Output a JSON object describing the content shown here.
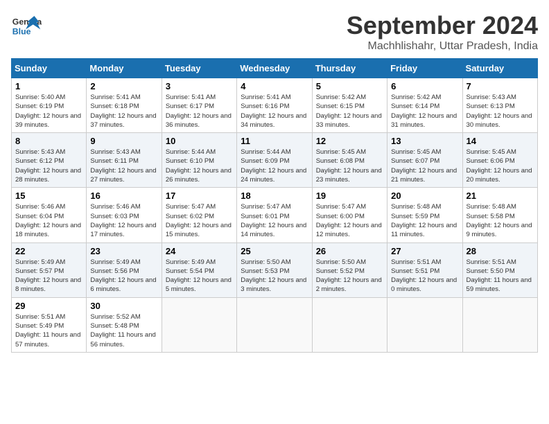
{
  "header": {
    "logo_general": "General",
    "logo_blue": "Blue",
    "month": "September 2024",
    "location": "Machhlishahr, Uttar Pradesh, India"
  },
  "weekdays": [
    "Sunday",
    "Monday",
    "Tuesday",
    "Wednesday",
    "Thursday",
    "Friday",
    "Saturday"
  ],
  "weeks": [
    [
      {
        "day": "1",
        "sunrise": "5:40 AM",
        "sunset": "6:19 PM",
        "daylight": "12 hours and 39 minutes."
      },
      {
        "day": "2",
        "sunrise": "5:41 AM",
        "sunset": "6:18 PM",
        "daylight": "12 hours and 37 minutes."
      },
      {
        "day": "3",
        "sunrise": "5:41 AM",
        "sunset": "6:17 PM",
        "daylight": "12 hours and 36 minutes."
      },
      {
        "day": "4",
        "sunrise": "5:41 AM",
        "sunset": "6:16 PM",
        "daylight": "12 hours and 34 minutes."
      },
      {
        "day": "5",
        "sunrise": "5:42 AM",
        "sunset": "6:15 PM",
        "daylight": "12 hours and 33 minutes."
      },
      {
        "day": "6",
        "sunrise": "5:42 AM",
        "sunset": "6:14 PM",
        "daylight": "12 hours and 31 minutes."
      },
      {
        "day": "7",
        "sunrise": "5:43 AM",
        "sunset": "6:13 PM",
        "daylight": "12 hours and 30 minutes."
      }
    ],
    [
      {
        "day": "8",
        "sunrise": "5:43 AM",
        "sunset": "6:12 PM",
        "daylight": "12 hours and 28 minutes."
      },
      {
        "day": "9",
        "sunrise": "5:43 AM",
        "sunset": "6:11 PM",
        "daylight": "12 hours and 27 minutes."
      },
      {
        "day": "10",
        "sunrise": "5:44 AM",
        "sunset": "6:10 PM",
        "daylight": "12 hours and 26 minutes."
      },
      {
        "day": "11",
        "sunrise": "5:44 AM",
        "sunset": "6:09 PM",
        "daylight": "12 hours and 24 minutes."
      },
      {
        "day": "12",
        "sunrise": "5:45 AM",
        "sunset": "6:08 PM",
        "daylight": "12 hours and 23 minutes."
      },
      {
        "day": "13",
        "sunrise": "5:45 AM",
        "sunset": "6:07 PM",
        "daylight": "12 hours and 21 minutes."
      },
      {
        "day": "14",
        "sunrise": "5:45 AM",
        "sunset": "6:06 PM",
        "daylight": "12 hours and 20 minutes."
      }
    ],
    [
      {
        "day": "15",
        "sunrise": "5:46 AM",
        "sunset": "6:04 PM",
        "daylight": "12 hours and 18 minutes."
      },
      {
        "day": "16",
        "sunrise": "5:46 AM",
        "sunset": "6:03 PM",
        "daylight": "12 hours and 17 minutes."
      },
      {
        "day": "17",
        "sunrise": "5:47 AM",
        "sunset": "6:02 PM",
        "daylight": "12 hours and 15 minutes."
      },
      {
        "day": "18",
        "sunrise": "5:47 AM",
        "sunset": "6:01 PM",
        "daylight": "12 hours and 14 minutes."
      },
      {
        "day": "19",
        "sunrise": "5:47 AM",
        "sunset": "6:00 PM",
        "daylight": "12 hours and 12 minutes."
      },
      {
        "day": "20",
        "sunrise": "5:48 AM",
        "sunset": "5:59 PM",
        "daylight": "12 hours and 11 minutes."
      },
      {
        "day": "21",
        "sunrise": "5:48 AM",
        "sunset": "5:58 PM",
        "daylight": "12 hours and 9 minutes."
      }
    ],
    [
      {
        "day": "22",
        "sunrise": "5:49 AM",
        "sunset": "5:57 PM",
        "daylight": "12 hours and 8 minutes."
      },
      {
        "day": "23",
        "sunrise": "5:49 AM",
        "sunset": "5:56 PM",
        "daylight": "12 hours and 6 minutes."
      },
      {
        "day": "24",
        "sunrise": "5:49 AM",
        "sunset": "5:54 PM",
        "daylight": "12 hours and 5 minutes."
      },
      {
        "day": "25",
        "sunrise": "5:50 AM",
        "sunset": "5:53 PM",
        "daylight": "12 hours and 3 minutes."
      },
      {
        "day": "26",
        "sunrise": "5:50 AM",
        "sunset": "5:52 PM",
        "daylight": "12 hours and 2 minutes."
      },
      {
        "day": "27",
        "sunrise": "5:51 AM",
        "sunset": "5:51 PM",
        "daylight": "12 hours and 0 minutes."
      },
      {
        "day": "28",
        "sunrise": "5:51 AM",
        "sunset": "5:50 PM",
        "daylight": "11 hours and 59 minutes."
      }
    ],
    [
      {
        "day": "29",
        "sunrise": "5:51 AM",
        "sunset": "5:49 PM",
        "daylight": "11 hours and 57 minutes."
      },
      {
        "day": "30",
        "sunrise": "5:52 AM",
        "sunset": "5:48 PM",
        "daylight": "11 hours and 56 minutes."
      },
      null,
      null,
      null,
      null,
      null
    ]
  ]
}
